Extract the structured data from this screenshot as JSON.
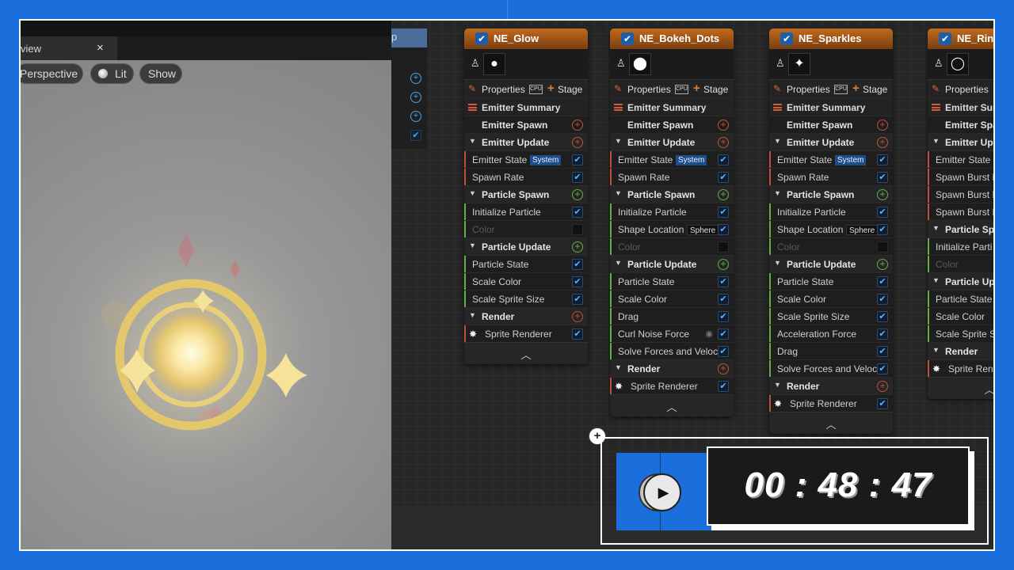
{
  "viewport": {
    "tab_label": "view",
    "tab_close": "×",
    "perspective_label": "Perspective",
    "lit_label": "Lit",
    "show_label": "Show"
  },
  "graph": {
    "partial_node_title": "p",
    "nodes": [
      {
        "title": "NE_Glow",
        "icon": "●",
        "properties_label": "Properties",
        "cpu_label": "CPU",
        "stage_label": "Stage",
        "rows": [
          {
            "kind": "summary",
            "label": "Emitter Summary"
          },
          {
            "kind": "stage",
            "label": "Emitter Spawn",
            "ctrl": "plus-red"
          },
          {
            "kind": "group",
            "label": "Emitter Update",
            "ctrl": "plus-red"
          },
          {
            "kind": "module",
            "label": "Emitter State",
            "tag": "System",
            "ctrl": "check",
            "bar": "#c0503a"
          },
          {
            "kind": "module",
            "label": "Spawn Rate",
            "ctrl": "check",
            "bar": "#c0503a"
          },
          {
            "kind": "group",
            "label": "Particle Spawn",
            "ctrl": "plus-green"
          },
          {
            "kind": "module",
            "label": "Initialize Particle",
            "ctrl": "check",
            "bar": "#5fb04a"
          },
          {
            "kind": "module",
            "label": "Color",
            "ctrl": "off",
            "dim": true,
            "bar": "#5fb04a"
          },
          {
            "kind": "group",
            "label": "Particle Update",
            "ctrl": "plus-green"
          },
          {
            "kind": "module",
            "label": "Particle State",
            "ctrl": "check",
            "bar": "#5fb04a"
          },
          {
            "kind": "module",
            "label": "Scale Color",
            "ctrl": "check",
            "bar": "#5fb04a"
          },
          {
            "kind": "module",
            "label": "Scale Sprite Size",
            "ctrl": "check",
            "bar": "#5fb04a"
          },
          {
            "kind": "group",
            "label": "Render",
            "ctrl": "plus-red"
          },
          {
            "kind": "renderer",
            "label": "Sprite Renderer",
            "ctrl": "check",
            "bar": "#c0503a"
          }
        ]
      },
      {
        "title": "NE_Bokeh_Dots",
        "icon": "⬤",
        "properties_label": "Properties",
        "cpu_label": "CPU",
        "stage_label": "Stage",
        "rows": [
          {
            "kind": "summary",
            "label": "Emitter Summary"
          },
          {
            "kind": "stage",
            "label": "Emitter Spawn",
            "ctrl": "plus-red"
          },
          {
            "kind": "group",
            "label": "Emitter Update",
            "ctrl": "plus-red"
          },
          {
            "kind": "module",
            "label": "Emitter State",
            "tag": "System",
            "ctrl": "check",
            "bar": "#c0503a"
          },
          {
            "kind": "module",
            "label": "Spawn Rate",
            "ctrl": "check",
            "bar": "#c0503a"
          },
          {
            "kind": "group",
            "label": "Particle Spawn",
            "ctrl": "plus-green"
          },
          {
            "kind": "module",
            "label": "Initialize Particle",
            "ctrl": "check",
            "bar": "#5fb04a"
          },
          {
            "kind": "module",
            "label": "Shape Location",
            "tag2": "Sphere",
            "ctrl": "check",
            "bar": "#5fb04a"
          },
          {
            "kind": "module",
            "label": "Color",
            "ctrl": "off",
            "dim": true,
            "bar": "#5fb04a"
          },
          {
            "kind": "group",
            "label": "Particle Update",
            "ctrl": "plus-green"
          },
          {
            "kind": "module",
            "label": "Particle State",
            "ctrl": "check",
            "bar": "#5fb04a"
          },
          {
            "kind": "module",
            "label": "Scale Color",
            "ctrl": "check",
            "bar": "#5fb04a"
          },
          {
            "kind": "module",
            "label": "Drag",
            "ctrl": "check",
            "bar": "#5fb04a"
          },
          {
            "kind": "module",
            "label": "Curl Noise Force",
            "ctrl": "check",
            "eye": true,
            "bar": "#5fb04a"
          },
          {
            "kind": "module",
            "label": "Solve Forces and Velocity",
            "ctrl": "check",
            "bar": "#5fb04a"
          },
          {
            "kind": "group",
            "label": "Render",
            "ctrl": "plus-red"
          },
          {
            "kind": "renderer",
            "label": "Sprite Renderer",
            "ctrl": "check",
            "bar": "#c0503a"
          }
        ]
      },
      {
        "title": "NE_Sparkles",
        "icon": "✦",
        "properties_label": "Properties",
        "cpu_label": "CPU",
        "stage_label": "Stage",
        "rows": [
          {
            "kind": "summary",
            "label": "Emitter Summary"
          },
          {
            "kind": "stage",
            "label": "Emitter Spawn",
            "ctrl": "plus-red"
          },
          {
            "kind": "group",
            "label": "Emitter Update",
            "ctrl": "plus-red"
          },
          {
            "kind": "module",
            "label": "Emitter State",
            "tag": "System",
            "ctrl": "check",
            "bar": "#c0503a"
          },
          {
            "kind": "module",
            "label": "Spawn Rate",
            "ctrl": "check",
            "bar": "#c0503a"
          },
          {
            "kind": "group",
            "label": "Particle Spawn",
            "ctrl": "plus-green"
          },
          {
            "kind": "module",
            "label": "Initialize Particle",
            "ctrl": "check",
            "bar": "#5fb04a"
          },
          {
            "kind": "module",
            "label": "Shape Location",
            "tag2": "Sphere",
            "ctrl": "check",
            "bar": "#5fb04a"
          },
          {
            "kind": "module",
            "label": "Color",
            "ctrl": "off",
            "dim": true,
            "bar": "#5fb04a"
          },
          {
            "kind": "group",
            "label": "Particle Update",
            "ctrl": "plus-green"
          },
          {
            "kind": "module",
            "label": "Particle State",
            "ctrl": "check",
            "bar": "#5fb04a"
          },
          {
            "kind": "module",
            "label": "Scale Color",
            "ctrl": "check",
            "bar": "#5fb04a"
          },
          {
            "kind": "module",
            "label": "Scale Sprite Size",
            "ctrl": "check",
            "bar": "#5fb04a"
          },
          {
            "kind": "module",
            "label": "Acceleration Force",
            "ctrl": "check",
            "bar": "#5fb04a"
          },
          {
            "kind": "module",
            "label": "Drag",
            "ctrl": "check",
            "bar": "#5fb04a"
          },
          {
            "kind": "module",
            "label": "Solve Forces and Velocity",
            "ctrl": "check",
            "bar": "#5fb04a"
          },
          {
            "kind": "group",
            "label": "Render",
            "ctrl": "plus-red"
          },
          {
            "kind": "renderer",
            "label": "Sprite Renderer",
            "ctrl": "check",
            "bar": "#c0503a"
          }
        ]
      },
      {
        "title": "NE_Ring",
        "icon": "◯",
        "properties_label": "Properties",
        "cpu_label": "",
        "stage_label": "",
        "rows": [
          {
            "kind": "summary",
            "label": "Emitter Sum"
          },
          {
            "kind": "stage",
            "label": "Emitter Spa",
            "ctrl": "none"
          },
          {
            "kind": "group",
            "label": "Emitter Upd",
            "ctrl": "none"
          },
          {
            "kind": "module",
            "label": "Emitter State",
            "ctrl": "none",
            "bar": "#c0503a"
          },
          {
            "kind": "module",
            "label": "Spawn Burst I",
            "ctrl": "none",
            "bar": "#c0503a"
          },
          {
            "kind": "module",
            "label": "Spawn Burst I",
            "ctrl": "none",
            "bar": "#c0503a"
          },
          {
            "kind": "module",
            "label": "Spawn Burst I",
            "ctrl": "none",
            "bar": "#c0503a"
          },
          {
            "kind": "group",
            "label": "Particle Spa",
            "ctrl": "none"
          },
          {
            "kind": "module",
            "label": "Initialize Parti",
            "ctrl": "none",
            "bar": "#5fb04a"
          },
          {
            "kind": "module",
            "label": "Color",
            "ctrl": "none",
            "dim": true,
            "bar": "#5fb04a"
          },
          {
            "kind": "group",
            "label": "Particle Up",
            "ctrl": "none"
          },
          {
            "kind": "module",
            "label": "Particle State",
            "ctrl": "none",
            "bar": "#5fb04a"
          },
          {
            "kind": "module",
            "label": "Scale Color",
            "ctrl": "none",
            "bar": "#5fb04a"
          },
          {
            "kind": "module",
            "label": "Scale Sprite S",
            "ctrl": "none",
            "bar": "#5fb04a"
          },
          {
            "kind": "group",
            "label": "Render",
            "ctrl": "none"
          },
          {
            "kind": "renderer",
            "label": "Sprite Ren",
            "ctrl": "none",
            "bar": "#c0503a"
          }
        ]
      }
    ]
  },
  "timer": {
    "time": "00 : 48 : 47",
    "play_icon": "▶"
  },
  "icons": {
    "tab_close": "close-icon",
    "lit": "lit-sphere-icon",
    "play": "play-icon",
    "corner_plus": "plus-icon"
  },
  "colors": {
    "background_blue": "#1a6fdc",
    "node_title_orange": "#c06a1e",
    "checkbox_blue": "#1e5ea8"
  }
}
